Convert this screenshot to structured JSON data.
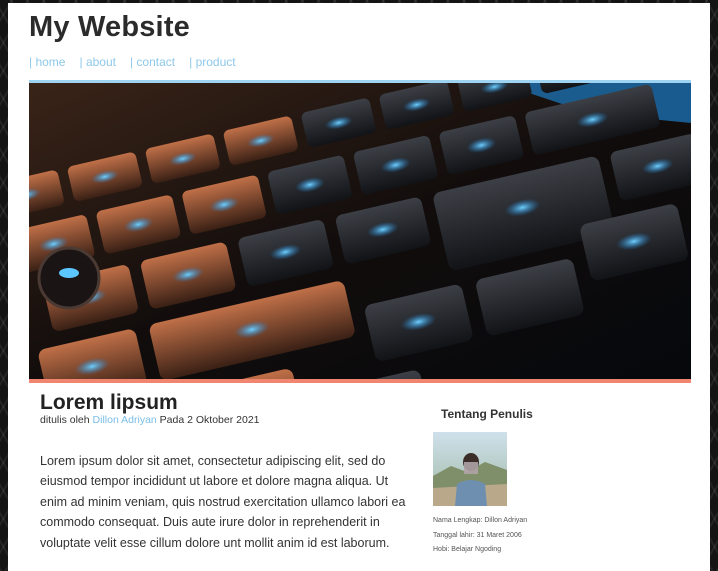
{
  "site": {
    "title": "My Website"
  },
  "nav": [
    {
      "label": "home"
    },
    {
      "label": "about"
    },
    {
      "label": "contact"
    },
    {
      "label": "product"
    }
  ],
  "hero": {
    "icon": "keyboard-photo"
  },
  "post": {
    "title": "Lorem lipsum",
    "byline_prefix": "ditulis oleh",
    "author": "Dillon Adriyan",
    "date": "Pada 2 Oktober 2021",
    "body": "Lorem ipsum dolor sit amet, consectetur adipiscing elit, sed do eiusmod tempor incididunt ut labore et dolore magna aliqua. Ut enim ad minim veniam, quis nostrud exercitation ullamco labori ea commodo consequat. Duis aute irure dolor in reprehenderit in voluptate velit esse cillum dolore unt mollit anim id est laborum."
  },
  "sidebar": {
    "title": "Tentang Penulis",
    "photo_icon": "author-portrait",
    "name": "Nama Lengkap: Dillon Adriyan",
    "birth": "Tanggal lahir: 31 Maret 2006",
    "hobby": "Hobi: Belajar Ngoding"
  },
  "colors": {
    "accent_link": "#8ec8ea",
    "hero_top_border": "#9fd3f2",
    "hero_bottom_border": "#f0866f"
  }
}
